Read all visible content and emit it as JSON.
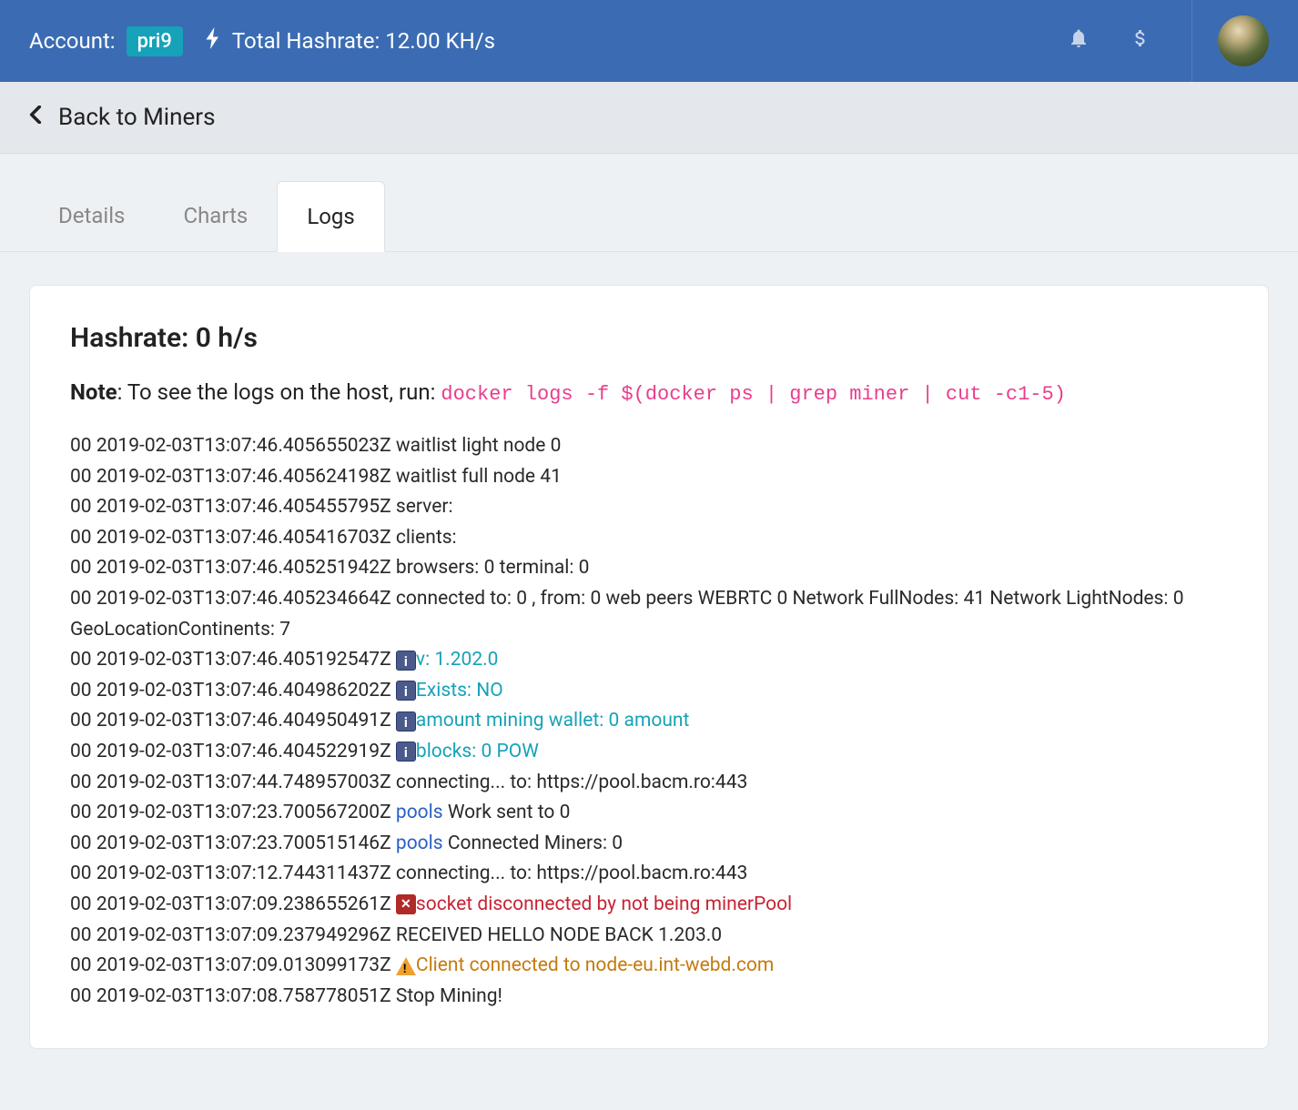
{
  "header": {
    "account_label": "Account:",
    "account_badge": "pri9",
    "hashrate_label": "Total Hashrate: 12.00 KH/s"
  },
  "subheader": {
    "back_label": "Back to Miners"
  },
  "tabs": {
    "details": "Details",
    "charts": "Charts",
    "logs": "Logs"
  },
  "card": {
    "title": "Hashrate: 0 h/s",
    "note_label": "Note",
    "note_text": ": To see the logs on the host, run: ",
    "note_code": "docker logs -f $(docker ps | grep miner | cut -c1-5)"
  },
  "logs": [
    {
      "prefix": "00 2019-02-03T13:07:46.405655023Z waitlist light node 0"
    },
    {
      "prefix": "00 2019-02-03T13:07:46.405624198Z waitlist full node 41"
    },
    {
      "prefix": "00 2019-02-03T13:07:46.405455795Z server:"
    },
    {
      "prefix": "00 2019-02-03T13:07:46.405416703Z clients:"
    },
    {
      "prefix": "00 2019-02-03T13:07:46.405251942Z browsers: 0 terminal: 0"
    },
    {
      "prefix": "00 2019-02-03T13:07:46.405234664Z connected to: 0 , from: 0 web peers WEBRTC 0 Network FullNodes: 41 Network LightNodes: 0 GeoLocationContinents: 7"
    },
    {
      "prefix": "00 2019-02-03T13:07:46.405192547Z ",
      "badge": "info",
      "colored": "v: 1.202.0",
      "color": "teal"
    },
    {
      "prefix": "00 2019-02-03T13:07:46.404986202Z ",
      "badge": "info",
      "colored": "Exists: NO",
      "color": "teal"
    },
    {
      "prefix": "00 2019-02-03T13:07:46.404950491Z ",
      "badge": "info",
      "colored": "amount mining wallet: 0 amount",
      "color": "teal"
    },
    {
      "prefix": "00 2019-02-03T13:07:46.404522919Z ",
      "badge": "info",
      "colored": "blocks: 0 POW",
      "color": "teal"
    },
    {
      "prefix": "00 2019-02-03T13:07:44.748957003Z connecting... to: https://pool.bacm.ro:443"
    },
    {
      "prefix": "00 2019-02-03T13:07:23.700567200Z ",
      "colored": "pools",
      "color": "blue",
      "suffix": " Work sent to 0"
    },
    {
      "prefix": "00 2019-02-03T13:07:23.700515146Z ",
      "colored": "pools",
      "color": "blue",
      "suffix": " Connected Miners: 0"
    },
    {
      "prefix": "00 2019-02-03T13:07:12.744311437Z connecting... to: https://pool.bacm.ro:443"
    },
    {
      "prefix": "00 2019-02-03T13:07:09.238655261Z ",
      "badge": "error",
      "colored": "socket disconnected by not being minerPool",
      "color": "red"
    },
    {
      "prefix": "00 2019-02-03T13:07:09.237949296Z RECEIVED HELLO NODE BACK 1.203.0"
    },
    {
      "prefix": "00 2019-02-03T13:07:09.013099173Z ",
      "badge": "warn",
      "colored": "Client connected to node-eu.int-webd.com",
      "color": "orange"
    },
    {
      "prefix": "00 2019-02-03T13:07:08.758778051Z Stop Mining!"
    }
  ]
}
